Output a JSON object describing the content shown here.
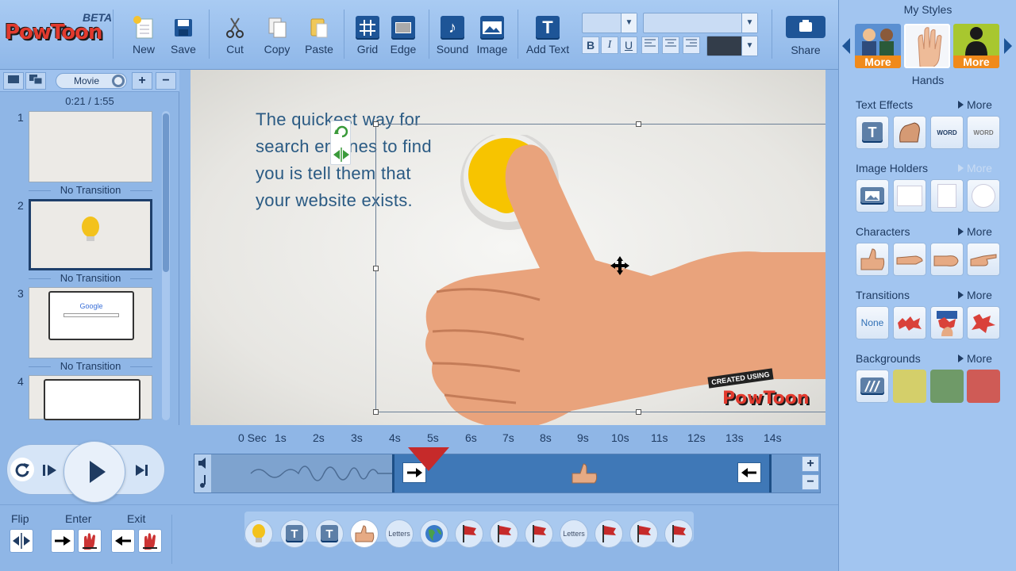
{
  "app": {
    "logo_text": "PowToon",
    "beta": "BETA"
  },
  "toolbar": {
    "new": "New",
    "save": "Save",
    "cut": "Cut",
    "copy": "Copy",
    "paste": "Paste",
    "grid": "Grid",
    "edge": "Edge",
    "sound": "Sound",
    "image": "Image",
    "add_text": "Add Text",
    "bold": "B",
    "italic": "I",
    "underline": "U",
    "share": "Share"
  },
  "left_panel": {
    "mode_label": "Movie",
    "time_display": "0:21 / 1:55",
    "add": "+",
    "remove": "−",
    "slides": [
      {
        "num": "1",
        "transition": "No Transition"
      },
      {
        "num": "2",
        "transition": "No Transition"
      },
      {
        "num": "3",
        "transition": "No Transition"
      },
      {
        "num": "4",
        "transition": ""
      }
    ],
    "thumb3_brand": "Google"
  },
  "canvas": {
    "headline_lines": [
      "The quickest way for",
      "search engines to find",
      "you is tell them that",
      "your website exists."
    ],
    "watermark_top": "CREATED USING",
    "watermark_brand": "PowToon"
  },
  "right_panel": {
    "title": "My Styles",
    "style_more": "More",
    "style_selected": "Hands",
    "sections": {
      "text_effects": {
        "title": "Text Effects",
        "more": "More"
      },
      "image_holders": {
        "title": "Image Holders",
        "more": "More"
      },
      "characters": {
        "title": "Characters",
        "more": "More"
      },
      "transitions": {
        "title": "Transitions",
        "more": "More",
        "none_label": "None"
      },
      "backgrounds": {
        "title": "Backgrounds",
        "more": "More"
      }
    },
    "background_colors": [
      "#d4cf6a",
      "#6f9a68",
      "#cf5b56"
    ],
    "text_effect_words": [
      "WORD",
      "WORD"
    ]
  },
  "timeline": {
    "ticks": [
      "0 Sec",
      "1s",
      "2s",
      "3s",
      "4s",
      "5s",
      "6s",
      "7s",
      "8s",
      "9s",
      "10s",
      "11s",
      "12s",
      "13s",
      "14s"
    ],
    "zoom_in": "+",
    "zoom_out": "−"
  },
  "bottom_bar": {
    "flip": "Flip",
    "enter": "Enter",
    "exit": "Exit",
    "strip_letters": "Letters"
  }
}
